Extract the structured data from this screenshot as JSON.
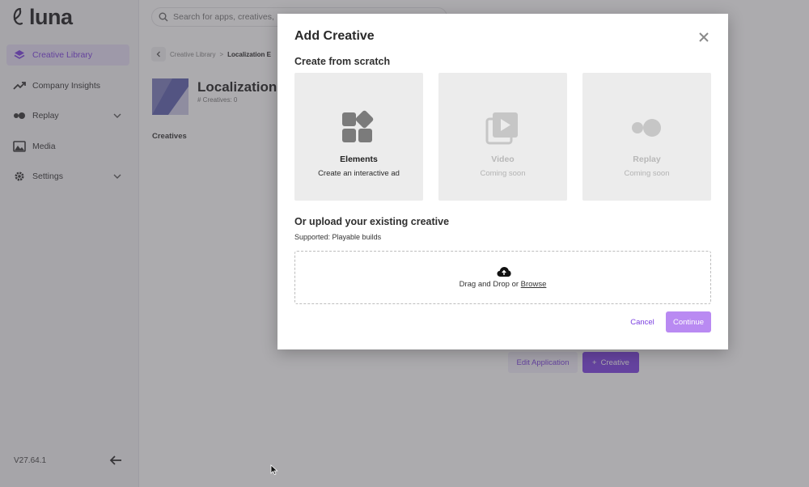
{
  "app": {
    "logo_text": "luna",
    "version": "V27.64.1"
  },
  "sidebar": {
    "items": [
      {
        "label": "Creative Library",
        "icon": "layers-icon",
        "active": true,
        "expandable": false
      },
      {
        "label": "Company Insights",
        "icon": "trend-icon",
        "active": false,
        "expandable": false
      },
      {
        "label": "Replay",
        "icon": "replay-icon",
        "active": false,
        "expandable": true
      },
      {
        "label": "Media",
        "icon": "media-icon",
        "active": false,
        "expandable": false
      },
      {
        "label": "Settings",
        "icon": "gear-icon",
        "active": false,
        "expandable": true
      }
    ]
  },
  "header": {
    "search_placeholder": "Search for apps, creatives,"
  },
  "breadcrumb": {
    "parent": "Creative Library",
    "separator": ">",
    "current": "Localization E"
  },
  "application": {
    "title": "Localization I",
    "count_label": "# Creatives: 0",
    "section_heading": "Creatives",
    "edit_label": "Edit Application",
    "add_creative_label": "Creative"
  },
  "modal": {
    "title": "Add Creative",
    "scratch_heading": "Create from scratch",
    "cards": [
      {
        "name": "Elements",
        "description": "Create an interactive ad",
        "icon": "elements-icon",
        "enabled": true
      },
      {
        "name": "Video",
        "description": "Coming soon",
        "icon": "video-icon",
        "enabled": false
      },
      {
        "name": "Replay",
        "description": "Coming soon",
        "icon": "replay-icon",
        "enabled": false
      }
    ],
    "upload_heading": "Or upload your existing creative",
    "supported_text": "Supported: Playable builds",
    "drop_text": "Drag and Drop or ",
    "browse_label": "Browse",
    "cancel_label": "Cancel",
    "continue_label": "Continue"
  },
  "colors": {
    "accent": "#7c3fe4",
    "accent_light": "#b98af2",
    "active_nav_bg": "#e6def6",
    "overlay": "#4b484e"
  }
}
